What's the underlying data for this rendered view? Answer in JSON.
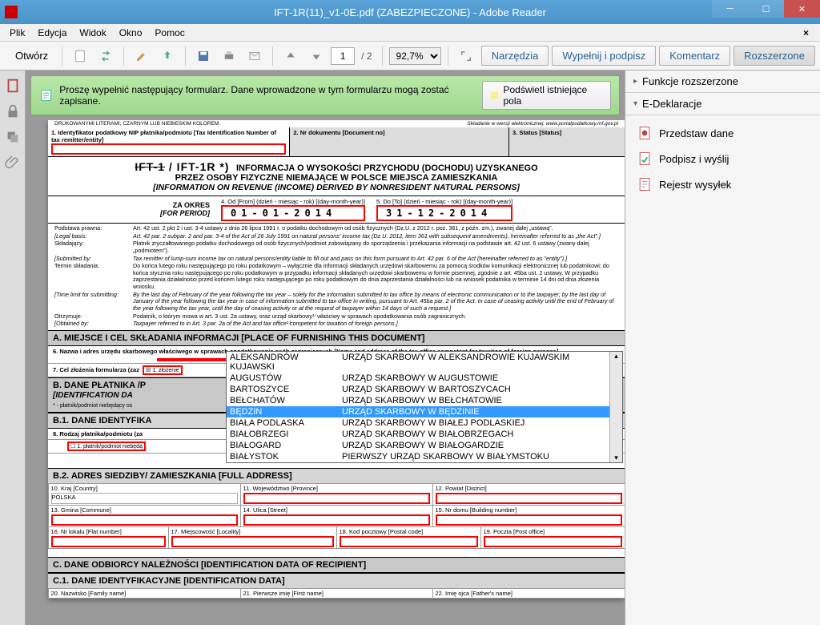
{
  "window": {
    "title": "IFT-1R(11)_v1-0E.pdf (ZABEZPIECZONE) - Adobe Reader"
  },
  "menu": {
    "file": "Plik",
    "edit": "Edycja",
    "view": "Widok",
    "window": "Okno",
    "help": "Pomoc"
  },
  "toolbar": {
    "open": "Otwórz",
    "page_current": "1",
    "page_total": "/ 2",
    "zoom": "92,7%",
    "narzedzia": "Narzędzia",
    "wypelnij": "Wypełnij i podpisz",
    "komentarz": "Komentarz",
    "rozszerzone": "Rozszerzone"
  },
  "msgbar": {
    "text": "Proszę wypełnić następujący formularz. Dane wprowadzone w tym formularzu mogą zostać zapisane.",
    "highlight": "Podświetl istniejące pola"
  },
  "form": {
    "top_note_left": "DRUKOWANYMI LITERAMI, CZARNYM LUB NIEBIESKIM KOLOREM.",
    "top_note_right": "Składanie w wersji elektronicznej: www.portalpodatkowy.mf.gov.pl",
    "field1_label": "1. Identyfikator podatkowy NIP płatnika/podmiotu [Tax Identification Number of tax remitter/entity]",
    "field2_label": "2. Nr dokumentu [Document no]",
    "field3_label": "3. Status [Status]",
    "code_strike": "IFT-1",
    "code_plain": " / IFT-1R *)",
    "title1": "INFORMACJA O WYSOKOŚCI PRZYCHODU (DOCHODU) UZYSKANEGO",
    "title2": "PRZEZ OSOBY FIZYCZNE NIEMAJĄCE W POLSCE MIEJSCA ZAMIESZKANIA",
    "title3": "[INFORMATION ON REVENUE (INCOME) DERIVED BY NONRESIDENT NATURAL PERSONS]",
    "za_okres": "ZA OKRES",
    "for_period": "[FOR PERIOD]",
    "od_label": "4. Od [From] (dzień - miesiąc - rok) [(day-month-year)]",
    "do_label": "5. Do [To] (dzień - miesiąc - rok) [(day-month-year)]",
    "date_from": "01-01-2014",
    "date_to": "31-12-2014",
    "legal": [
      {
        "k": "Podstawa prawna:",
        "v": "Art. 42 ust. 2 pkt 2 i ust. 3-4 ustawy z dnia 26 lipca 1991 r. o podatku dochodowym od osób fizycznych (Dz.U. z 2012 r. poz. 361, z późn. zm.), zwanej dalej „ustawą\"."
      },
      {
        "k": "[Legal basis:",
        "v": "Art. 42 par. 2 subpar. 2 and par. 3-4 of the Act of 26 July 1991 on natural persons' income tax (Dz.U. 2012, item 361 with subsequent amendments), hereinafter referred to as „the Act\".]",
        "it": true
      },
      {
        "k": "Składający:",
        "v": "Płatnik zryczałtowanego podatku dochodowego od osób fizycznych/podmiot zobowiązany do sporządzenia i przekazania informacji na podstawie art. 42 ust. 6 ustawy (zwany dalej „podmiotem\")."
      },
      {
        "k": "[Submitted by:",
        "v": "Tax remitter of lump-sum income tax on natural persons/entity liable to fill out and pass on this form pursuant to Art. 42 par. 6 of the Act (hereinafter referred to as \"entity\").]",
        "it": true
      },
      {
        "k": "Termin składania:",
        "v": "Do końca lutego roku następującego po roku podatkowym – wyłącznie dla informacji składanych urzędowi skarbowemu za pomocą środków komunikacji elektronicznej lub podatnikowi; do końca stycznia roku następującego po roku podatkowym w przypadku informacji składanych urzędowi skarbowemu w formie pisemnej, zgodnie z art. 45ba ust. 2 ustawy. W przypadku zaprzestania działalności przed końcem lutego roku następującego po roku podatkowym do dnia zaprzestania działalności lub na wniosek podatnika w terminie 14 dni od dnia złożenia wniosku."
      },
      {
        "k": "[Time limit for submitting:",
        "v": "By the last day of February of the year following the tax year – solely for the information submitted to tax office by means of electronic communication or to the taxpayer; by the last day of January of the year following the tax year in case of information submitted to tax office in writing, pursuant to Art. 45ba par. 2 of the Act. In case of ceasing activity until the end of February of the year following the tax year, until the day of ceasing activity or at the request of taxpayer within 14 days of such a request.]",
        "it": true
      },
      {
        "k": "Otrzymuje:",
        "v": "Podatnik, o którym mowa w art. 3 ust. 2a ustawy, oraz urząd skarbowy¹⁾ właściwy w sprawach opodatkowania osób zagranicznych."
      },
      {
        "k": "[Obtained by:",
        "v": "Taxpayer referred to in Art. 3 par. 2a of the Act and tax office¹⁾competent for taxation of foreign persons.]",
        "it": true
      }
    ],
    "secA": "A. MIEJSCE I CEL SKŁADANIA INFORMACJI [PLACE OF FURNISHING THIS DOCUMENT]",
    "field6": "6. Nazwa i adres urzędu skarbowego właściwego w sprawach opodatkowania osób zagranicznych [Name and address of the tax office competent for taxation of foreign persons]",
    "field7": "7. Cel złożenia formularza (zaz",
    "field7_opt": "1. złożenie",
    "secB": "B. DANE PŁATNIKA /P",
    "secB_sub": "[IDENTIFICATION DA",
    "secB_note": "* - płatnik/podmiot niebędący os",
    "secB1": "B.1. DANE IDENTYFIKA",
    "field8": "8. Rodzaj płatnika/podmiotu (za",
    "field8_opt": "1. płatnik/podmiot niebędą",
    "secB2": "B.2. ADRES SIEDZIBY/ ZAMIESZKANIA [FULL ADDRESS]",
    "f10": "10. Kraj [Country]",
    "f10v": "POLSKA",
    "f11": "11. Województwo [Province]",
    "f12": "12. Powiat [District]",
    "f13": "13. Gmina [Commune]",
    "f14": "14. Ulica [Street]",
    "f15": "15. Nr domu [Building number]",
    "f16": "16. Nr lokalu [Flat number]",
    "f17": "17. Miejscowość [Locality]",
    "f18": "18. Kod pocztowy [Postal code]",
    "f19": "19. Poczta [Post office]",
    "secC": "C. DANE ODBIORCY NALEŻNOŚCI [IDENTIFICATION DATA OF RECIPIENT]",
    "secC1": "C.1. DANE IDENTYFIKACYJNE [IDENTIFICATION DATA]",
    "f20": "20. Nazwisko [Family name]",
    "f21": "21. Pierwsze imię [First name]",
    "f22": "22. Imię ojca [Father's name]"
  },
  "dropdown": {
    "items": [
      {
        "c1": "ALEKSANDRÓW KUJAWSKI",
        "c2": "URZĄD SKARBOWY W ALEKSANDROWIE KUJAWSKIM"
      },
      {
        "c1": "AUGUSTÓW",
        "c2": "URZĄD SKARBOWY W AUGUSTOWIE"
      },
      {
        "c1": "BARTOSZYCE",
        "c2": "URZĄD SKARBOWY W BARTOSZYCACH"
      },
      {
        "c1": "BEŁCHATÓW",
        "c2": "URZĄD SKARBOWY W BEŁCHATOWIE"
      },
      {
        "c1": "BĘDZIN",
        "c2": "URZĄD SKARBOWY W BĘDZINIE",
        "sel": true
      },
      {
        "c1": "BIAŁA PODLASKA",
        "c2": "URZĄD SKARBOWY W BIAŁEJ PODLASKIEJ"
      },
      {
        "c1": "BIAŁOBRZEGI",
        "c2": "URZĄD SKARBOWY W BIAŁOBRZEGACH"
      },
      {
        "c1": "BIAŁOGARD",
        "c2": "URZĄD SKARBOWY W BIAŁOGARDZIE"
      },
      {
        "c1": "BIAŁYSTOK",
        "c2": "PIERWSZY URZĄD SKARBOWY W BIAŁYMSTOKU"
      }
    ]
  },
  "rightpanel": {
    "sec1": "Funkcje rozszerzone",
    "sec2": "E-Deklaracje",
    "items": [
      "Przedstaw dane",
      "Podpisz i wyślij",
      "Rejestr wysyłek"
    ]
  }
}
